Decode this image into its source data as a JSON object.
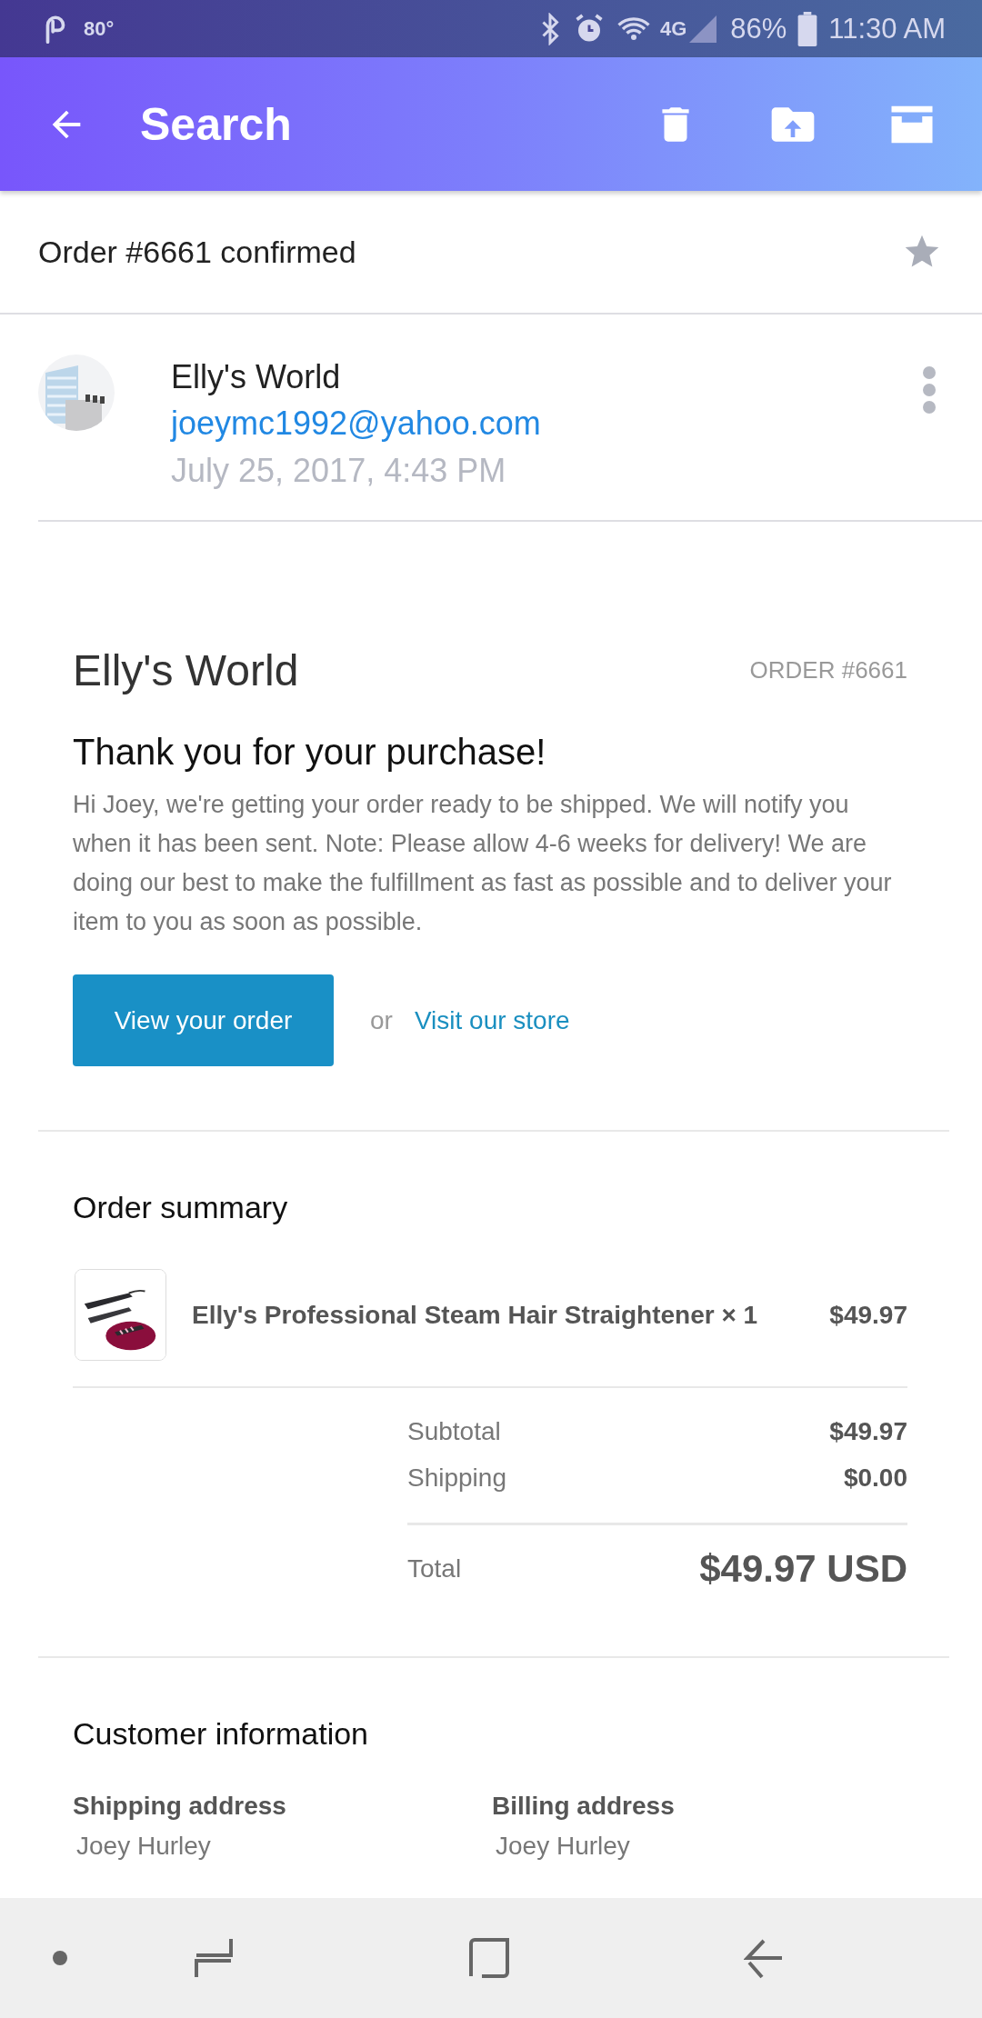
{
  "status_bar": {
    "temperature": "80°",
    "network": "4G",
    "battery": "86%",
    "time": "11:30 AM"
  },
  "app_bar": {
    "title": "Search"
  },
  "subject": {
    "text": "Order #6661 confirmed",
    "starred": false
  },
  "sender": {
    "name": "Elly's World",
    "email": "joeymc1992@yahoo.com",
    "date": "July 25, 2017, 4:43 PM"
  },
  "email": {
    "store_name": "Elly's World",
    "order_label": "ORDER #6661",
    "heading": "Thank you for your purchase!",
    "message": "Hi Joey, we're getting your order ready to be shipped. We will notify you when it has been sent. Note: Please allow 4-6 weeks for delivery! We are doing our best to make the fulfillment as fast as possible and to deliver your item to you as soon as possible.",
    "primary_button": "View your order",
    "separator": "or",
    "link": "Visit our store",
    "summary": {
      "title": "Order summary",
      "items": [
        {
          "name": "Elly's Professional Steam Hair Straightener × 1",
          "price": "$49.97"
        }
      ],
      "totals": [
        {
          "label": "Subtotal",
          "value": "$49.97"
        },
        {
          "label": "Shipping",
          "value": "$0.00"
        }
      ],
      "total": {
        "label": "Total",
        "value": "$49.97 USD"
      }
    },
    "customer": {
      "title": "Customer information",
      "columns": [
        {
          "heading": "Shipping address",
          "lines": [
            "Joey Hurley"
          ]
        },
        {
          "heading": "Billing address",
          "lines": [
            "Joey Hurley"
          ]
        }
      ]
    }
  }
}
